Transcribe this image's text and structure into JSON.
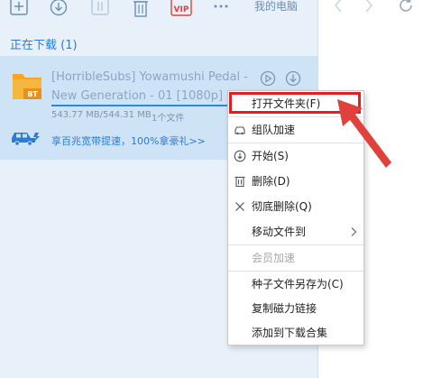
{
  "toolbar": {
    "items": [
      {
        "icon": "plus-box-icon"
      },
      {
        "icon": "download-circle-icon"
      },
      {
        "icon": "pause-box-icon"
      },
      {
        "icon": "trash-icon"
      },
      {
        "icon": "vip-icon",
        "label": "VIP"
      },
      {
        "icon": "more-dots-icon",
        "label": "···"
      }
    ],
    "location_label": "我的电脑"
  },
  "downloading": {
    "header": "正在下载 (1)"
  },
  "download_item": {
    "file_type_badge": "BT",
    "name": "[HorribleSubs] Yowamushi Pedal - New Generation - 01 [1080p]",
    "size_text": "543.77 MB/544.31 MB",
    "file_count": "1个文件",
    "progress": 0.999,
    "promo_text": "享百兆宽带提速，100%拿豪礼>>"
  },
  "context_menu": {
    "items": [
      {
        "label": "打开文件夹(F)",
        "icon": "",
        "enabled": true,
        "highlighted": true
      },
      {
        "label": "组队加速",
        "icon": "car-icon",
        "enabled": true
      },
      {
        "label": "开始(S)",
        "icon": "download-circle-icon",
        "enabled": true
      },
      {
        "label": "删除(D)",
        "icon": "trash-icon",
        "enabled": true
      },
      {
        "label": "彻底删除(Q)",
        "icon": "close-icon",
        "enabled": true
      },
      {
        "label": "移动文件到",
        "icon": "",
        "enabled": true,
        "submenu": true
      },
      {
        "label": "会员加速",
        "icon": "",
        "enabled": false
      },
      {
        "label": "种子文件另存为(C)",
        "icon": "",
        "enabled": true
      },
      {
        "label": "复制磁力链接",
        "icon": "",
        "enabled": true
      },
      {
        "label": "添加到下载合集",
        "icon": "",
        "enabled": true
      }
    ]
  },
  "colors": {
    "accent": "#2a7cd6",
    "panel_bg": "#e8f1fa",
    "item_selected_bg": "#cfe3f6",
    "annotation_red": "#e02020",
    "folder_orange": "#f5a623"
  }
}
